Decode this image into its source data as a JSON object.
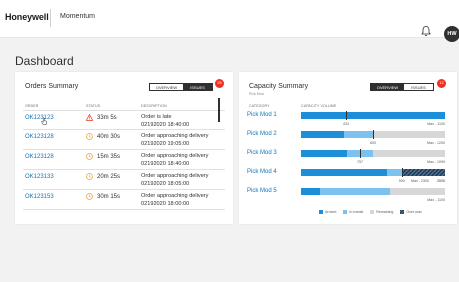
{
  "header": {
    "brand": "Honeywell",
    "app_name": "Momentum",
    "user_initials": "HW",
    "icons": [
      "bell-icon",
      "avatar"
    ]
  },
  "page": {
    "title": "Dashboard"
  },
  "colors": {
    "accent": "#1274b7",
    "arrived": "#1c8fd8",
    "in_transit": "#7cc2ee",
    "remaining": "#d7d7d7",
    "badge": "#ee3124",
    "dark": "#303030"
  },
  "orders": {
    "title": "Orders Summary",
    "tabs": {
      "overview": "OVERVIEW",
      "issues": "ISSUES"
    },
    "issues_count": "25",
    "columns": {
      "order": "ORDER",
      "status": "STATUS",
      "description": "DESCRIPTION"
    },
    "rows": [
      {
        "id": "OK123123",
        "status_icon": "warning-triangle-icon",
        "status": "33m 5s",
        "desc": "Order is late",
        "time": "02192020  18:40:00"
      },
      {
        "id": "OK123128",
        "status_icon": "clock-icon",
        "status": "40m 30s",
        "desc": "Order approaching delivery",
        "time": "02192020  19:05:00"
      },
      {
        "id": "OK123128",
        "status_icon": "clock-icon",
        "status": "15m 35s",
        "desc": "Order approaching delivery",
        "time": "02192020  18:40:00"
      },
      {
        "id": "OK123133",
        "status_icon": "clock-icon",
        "status": "20m 25s",
        "desc": "Order approaching delivery",
        "time": "02192020  18:05:00"
      },
      {
        "id": "OK123153",
        "status_icon": "clock-icon",
        "status": "30m 15s",
        "desc": "Order approaching delivery",
        "time": "02192020  18:00:00"
      }
    ]
  },
  "capacity": {
    "title": "Capacity Summary",
    "subtitle": "Pick Mod",
    "tabs": {
      "overview": "OVERVIEW",
      "issues": "ISSUES"
    },
    "issues_count": "12",
    "columns": {
      "category": "CATEGORY",
      "volume": "CAPACITY VOLUME"
    },
    "rows": [
      {
        "name": "Pick Mod 1",
        "arrived": 1.0,
        "in_transit": 0,
        "over": 0,
        "marker": 0.315,
        "marker_label": "631",
        "max_label": "Max - 1100"
      },
      {
        "name": "Pick Mod 2",
        "arrived": 0.3,
        "in_transit": 0.2,
        "over": 0,
        "marker": 0.5,
        "marker_label": "600",
        "max_label": "Max - 1200"
      },
      {
        "name": "Pick Mod 3",
        "arrived": 0.32,
        "in_transit": 0.18,
        "over": 0,
        "marker": 0.41,
        "marker_label": "757",
        "max_label": "Max - 1099"
      },
      {
        "name": "Pick Mod 4",
        "arrived": 0.6,
        "in_transit": 0.1,
        "over": 0.3,
        "marker": 0.7,
        "marker_label": "900",
        "max_label": "Max - 2300",
        "over_label": "2000"
      },
      {
        "name": "Pick Mod 5",
        "arrived": 0.13,
        "in_transit": 0.49,
        "over": 0,
        "marker": 0,
        "marker_label": "",
        "max_label": "Max - 1100"
      }
    ],
    "legend": {
      "arrived": "Arrived",
      "in_transit": "In transit",
      "remaining": "Remaining",
      "over_max": "Over max"
    }
  }
}
